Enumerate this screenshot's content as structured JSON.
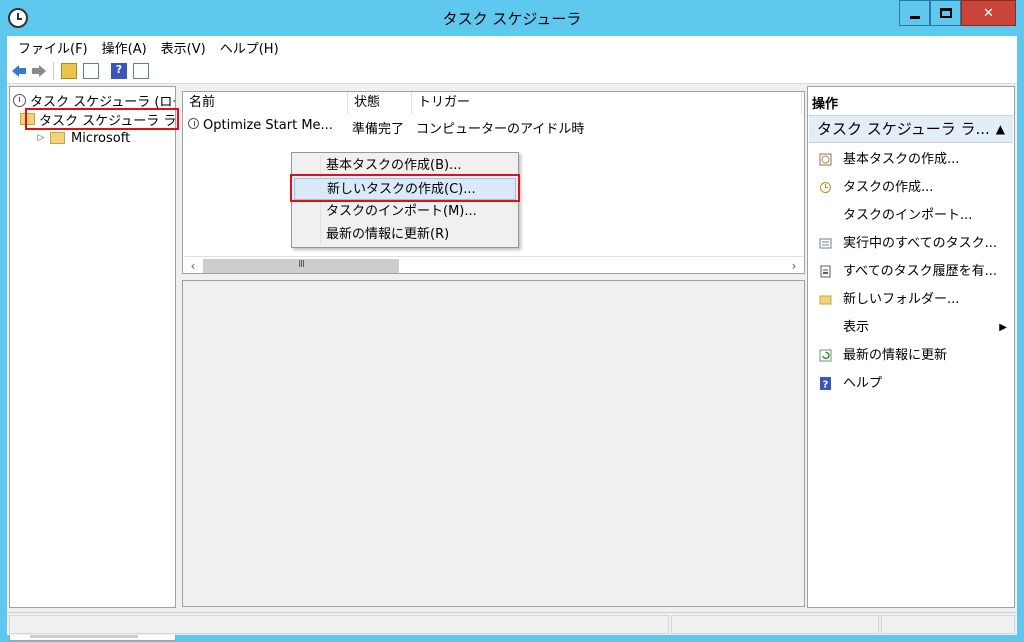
{
  "window": {
    "title": "タスク スケジューラ"
  },
  "menubar": [
    "ファイル(F)",
    "操作(A)",
    "表示(V)",
    "ヘルプ(H)"
  ],
  "tree": {
    "root": "タスク スケジューラ (ローカル)",
    "library": "タスク スケジューラ ライブラリ",
    "child": "Microsoft"
  },
  "table": {
    "columns": [
      "名前",
      "状態",
      "トリガー"
    ],
    "rows": [
      {
        "name": "Optimize Start Me...",
        "status": "準備完了",
        "trigger": "コンピューターのアイドル時"
      }
    ]
  },
  "context_menu": [
    "基本タスクの作成(B)...",
    "新しいタスクの作成(C)...",
    "タスクのインポート(M)...",
    "最新の情報に更新(R)"
  ],
  "actions": {
    "title": "操作",
    "group": "タスク スケジューラ ラ...",
    "items": [
      "基本タスクの作成...",
      "タスクの作成...",
      "タスクのインポート...",
      "実行中のすべてのタスク...",
      "すべてのタスク履歴を有...",
      "新しいフォルダー...",
      "表示",
      "最新の情報に更新",
      "ヘルプ"
    ]
  },
  "scrollbar": {
    "grip": "III"
  },
  "colors": {
    "highlight": "#e0101a",
    "titlebar": "#5fc8ee",
    "close": "#c9453a"
  }
}
